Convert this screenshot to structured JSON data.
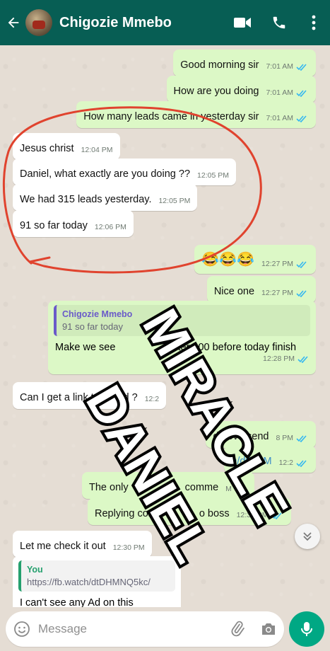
{
  "header": {
    "contact_name": "Chigozie Mmebo",
    "back_icon": "arrow-left-icon",
    "video_icon": "video-call-icon",
    "call_icon": "phone-icon",
    "menu_icon": "more-vertical-icon"
  },
  "messages": [
    {
      "dir": "out",
      "text": "Good morning sir",
      "time": "7:01 AM",
      "read": true
    },
    {
      "dir": "out",
      "text": "How are you doing",
      "time": "7:01 AM",
      "read": true
    },
    {
      "dir": "out",
      "text": "How many leads came in yesterday sir",
      "time": "7:01 AM",
      "read": true
    },
    {
      "dir": "in",
      "text": "Jesus christ",
      "time": "12:04 PM"
    },
    {
      "dir": "in",
      "text": "Daniel, what exactly are you doing ??",
      "time": "12:05 PM"
    },
    {
      "dir": "in",
      "text": "We had 315 leads yesterday.",
      "time": "12:05 PM"
    },
    {
      "dir": "in",
      "text": "91 so far today",
      "time": "12:06 PM"
    },
    {
      "dir": "out",
      "text": "😂😂😂",
      "time": "12:27 PM",
      "read": true
    },
    {
      "dir": "out",
      "text": "Nice one",
      "time": "12:27 PM",
      "read": true
    },
    {
      "dir": "out",
      "quote_name": "Chigozie Mmebo",
      "quote_text": "91 so far today",
      "text": "Make we see if we fit reach like over 400 before today finish",
      "visible_text_parts": [
        "Make we see",
        "ter 400 before today finish"
      ],
      "time": "12:28 PM",
      "read": true
    },
    {
      "dir": "in",
      "text": "Can I get a link to",
      "text_tail": "Ad ?",
      "time": "12:2"
    },
    {
      "dir": "out",
      "text": "d nova send",
      "time": "8 PM",
      "read": true
    },
    {
      "dir": "out",
      "text": "h/dtDHM",
      "time": "12:2",
      "read": true
    },
    {
      "dir": "out",
      "text": "The only",
      "text_tail": "comme",
      "time": "M",
      "read": true
    },
    {
      "dir": "out",
      "text": "Replying com",
      "text_tail": "o boss",
      "time": "12:30 PM",
      "read": true
    },
    {
      "dir": "in",
      "text": "Let me check it out",
      "time": "12:30 PM"
    },
    {
      "dir": "in",
      "quote_name": "You",
      "quote_text": "https://fb.watch/dtDHMNQ5kc/",
      "text": "I can't see any Ad on this",
      "time": ""
    }
  ],
  "watermark": {
    "line1": "MIRACLE",
    "line2": "DANIEL"
  },
  "input": {
    "placeholder": "Message",
    "emoji_icon": "emoji-icon",
    "attach_icon": "paperclip-icon",
    "camera_icon": "camera-icon",
    "mic_icon": "mic-icon"
  },
  "colors": {
    "header": "#075e54",
    "outgoing_bubble": "#dcf8c6",
    "incoming_bubble": "#ffffff",
    "read_ticks": "#34b7f1",
    "annotation_circle": "#e0432e",
    "mic_button": "#00a884"
  }
}
